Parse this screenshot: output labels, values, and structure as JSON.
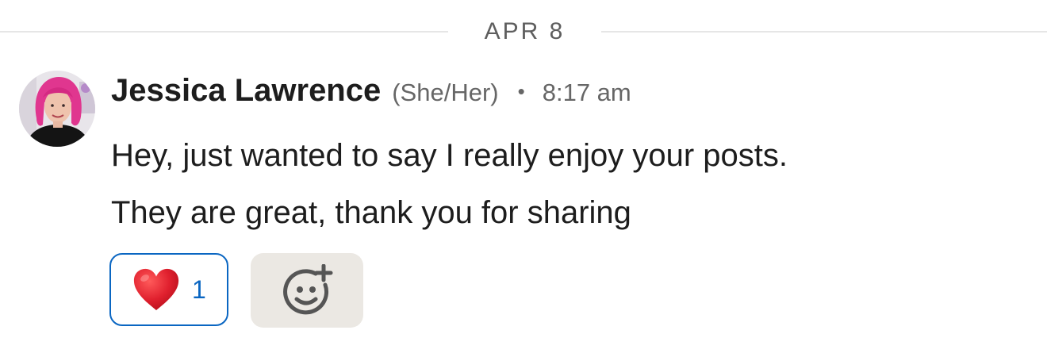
{
  "date_divider": {
    "label": "APR 8"
  },
  "message": {
    "sender_name": "Jessica Lawrence",
    "pronouns": "(She/Her)",
    "separator": "•",
    "timestamp": "8:17 am",
    "lines": [
      "Hey, just wanted to say I really enjoy your posts.",
      "They are great, thank you for sharing"
    ],
    "avatar_icon": "profile-photo"
  },
  "reactions": [
    {
      "icon": "red-heart-icon",
      "count": "1",
      "selected": true
    }
  ],
  "add_reaction": {
    "icon": "add-emoji-smiley-icon"
  },
  "colors": {
    "accent": "#0a66c2",
    "text_primary": "#1d1d1d",
    "text_secondary": "#666666",
    "divider": "#e6e6e6",
    "add_reaction_bg": "#ebe8e3",
    "heart": "#e0202e"
  }
}
